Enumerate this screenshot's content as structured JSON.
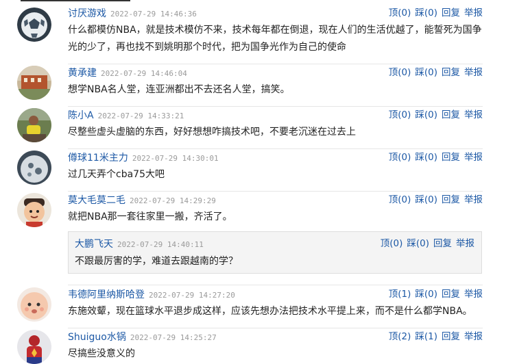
{
  "comments": [
    {
      "user": "讨厌游戏",
      "time": "2022-07-29 14:46:36",
      "text": "什么都模仿NBA，就是技术模仿不来，技术每年都在倒退，现在人们的生活优越了，能誓死为国争光的少了，再也找不到姚明那个时代，把为国争光作为自己的使命",
      "up": "顶(0)",
      "down": "踩(0)",
      "reply": "回复",
      "report": "举报",
      "avatar": "soccer-ball-avatar"
    },
    {
      "user": "黄承建",
      "time": "2022-07-29 14:46:04",
      "text": "想学NBA名人堂，连亚洲都出不去还名人堂，搞笑。",
      "up": "顶(0)",
      "down": "踩(0)",
      "reply": "回复",
      "report": "举报",
      "avatar": "building-avatar"
    },
    {
      "user": "陈小A",
      "time": "2022-07-29 14:33:21",
      "text": "尽整些虚头虚脑的东西，好好想想咋搞技术吧，不要老沉迷在过去上",
      "up": "顶(0)",
      "down": "踩(0)",
      "reply": "回复",
      "report": "举报",
      "avatar": "person-avatar"
    },
    {
      "user": "僔球11米主力",
      "time": "2022-07-29 14:30:01",
      "text": "过几天弄个cba75大吧",
      "up": "顶(0)",
      "down": "踩(0)",
      "reply": "回复",
      "report": "举报",
      "avatar": "ball-avatar"
    },
    {
      "user": "莫大毛莫二毛",
      "time": "2022-07-29 14:29:29",
      "text": "就把NBA那一套往家里一搬，齐活了。",
      "up": "顶(0)",
      "down": "踩(0)",
      "reply": "回复",
      "report": "举报",
      "avatar": "cartoon-boy-avatar"
    },
    {
      "user": "韦德阿里纳斯哈登",
      "time": "2022-07-29 14:27:20",
      "text": "东施效颦，现在篮球水平退步成这样，应该先想办法把技术水平提上来，而不是什么都学NBA。",
      "up": "顶(1)",
      "down": "踩(0)",
      "reply": "回复",
      "report": "举报",
      "avatar": "baby-avatar"
    },
    {
      "user": "Shuiguo水锅",
      "time": "2022-07-29 14:25:27",
      "text": "尽搞些没意义的",
      "up": "顶(2)",
      "down": "踩(1)",
      "reply": "回复",
      "report": "举报",
      "avatar": "superhero-avatar"
    }
  ],
  "reply_block": {
    "user": "大鹏飞天",
    "time": "2022-07-29 14:40:11",
    "text": "不跟最厉害的学，难道去跟越南的学？",
    "up": "顶(0)",
    "down": "踩(0)",
    "reply": "回复",
    "report": "举报"
  }
}
